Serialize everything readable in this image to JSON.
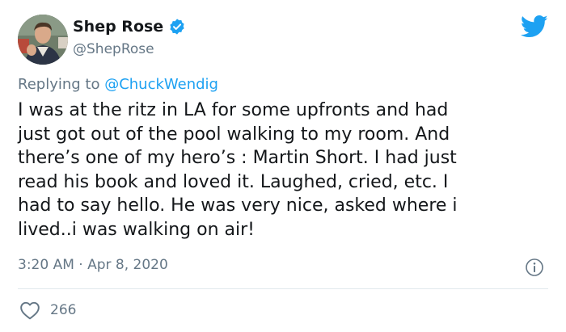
{
  "author": {
    "display_name": "Shep Rose",
    "handle": "@ShepRose",
    "verified": true
  },
  "reply": {
    "prefix": "Replying to ",
    "mention": "@ChuckWendig"
  },
  "tweet": {
    "text": "I was at the ritz in LA for some upfronts and had\njust got out of the pool walking to my room. And\nthere’s one of my hero’s : Martin Short. I had just\nread his book and loved it. Laughed, cried, etc. I\nhad to say hello. He was very nice, asked where i\nlived..i was walking on air!",
    "timestamp": "3:20 AM · Apr 8, 2020",
    "likes": "266"
  },
  "icons": {
    "brand": "twitter-bird-icon",
    "verified": "verified-badge-icon",
    "info": "info-icon",
    "like": "heart-icon"
  },
  "colors": {
    "brand_blue": "#1da1f2",
    "secondary_text": "#657786",
    "primary_text": "#14171a",
    "divider": "#e1e8ed"
  }
}
